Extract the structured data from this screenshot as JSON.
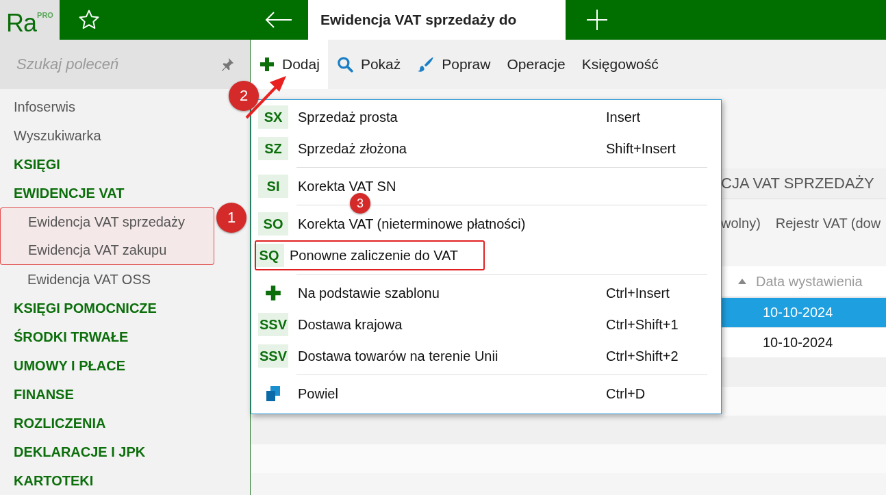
{
  "app": {
    "logo": "Ra",
    "logo_badge": "PRO"
  },
  "tab": {
    "title": "Ewidencja VAT sprzedaży do"
  },
  "search": {
    "placeholder": "Szukaj poleceń"
  },
  "sidebar": {
    "items": [
      {
        "kind": "link",
        "label": "Infoserwis",
        "highlighted": false
      },
      {
        "kind": "link",
        "label": "Wyszukiwarka",
        "highlighted": false
      },
      {
        "kind": "section",
        "label": "KSIĘGI",
        "highlighted": false
      },
      {
        "kind": "section",
        "label": "EWIDENCJE VAT",
        "highlighted": false
      },
      {
        "kind": "sub",
        "label": "Ewidencja VAT sprzedaży",
        "highlighted": true
      },
      {
        "kind": "sub",
        "label": "Ewidencja VAT zakupu",
        "highlighted": true
      },
      {
        "kind": "sub",
        "label": "Ewidencja VAT OSS",
        "highlighted": false
      },
      {
        "kind": "section",
        "label": "KSIĘGI POMOCNICZE",
        "highlighted": false
      },
      {
        "kind": "section",
        "label": "ŚRODKI TRWAŁE",
        "highlighted": false
      },
      {
        "kind": "section",
        "label": "UMOWY I PŁACE",
        "highlighted": false
      },
      {
        "kind": "section",
        "label": "FINANSE",
        "highlighted": false
      },
      {
        "kind": "section",
        "label": "ROZLICZENIA",
        "highlighted": false
      },
      {
        "kind": "section",
        "label": "DEKLARACJE I JPK",
        "highlighted": false
      },
      {
        "kind": "section",
        "label": "KARTOTEKI",
        "highlighted": false
      }
    ]
  },
  "toolbar": [
    {
      "kind": "add",
      "label": "Dodaj",
      "selected": true
    },
    {
      "kind": "search",
      "label": "Pokaż",
      "selected": false
    },
    {
      "kind": "brush",
      "label": "Popraw",
      "selected": false
    },
    {
      "kind": "text",
      "label": "Operacje",
      "selected": false
    },
    {
      "kind": "text",
      "label": "Księgowość",
      "selected": false
    }
  ],
  "menu": [
    {
      "kind": "code",
      "code": "SX",
      "label": "Sprzedaż prosta",
      "shortcut": "Insert",
      "highlighted": false
    },
    {
      "kind": "code",
      "code": "SZ",
      "label": "Sprzedaż złożona",
      "shortcut": "Shift+Insert",
      "highlighted": false
    },
    {
      "kind": "separator"
    },
    {
      "kind": "code",
      "code": "SI",
      "label": "Korekta VAT SN",
      "highlighted": false
    },
    {
      "kind": "separator"
    },
    {
      "kind": "code",
      "code": "SO",
      "label": "Korekta VAT (nieterminowe płatności)",
      "highlighted": false
    },
    {
      "kind": "code",
      "code": "SQ",
      "label": "Ponowne zaliczenie do VAT",
      "highlighted": true
    },
    {
      "kind": "separator"
    },
    {
      "kind": "plus",
      "label": "Na podstawie szablonu",
      "shortcut": "Ctrl+Insert",
      "highlighted": false
    },
    {
      "kind": "code",
      "code": "SSV",
      "label": "Dostawa krajowa",
      "shortcut": "Ctrl+Shift+1",
      "highlighted": false
    },
    {
      "kind": "code",
      "code": "SSV",
      "label": "Dostawa towarów na terenie Unii",
      "shortcut": "Ctrl+Shift+2",
      "highlighted": false
    },
    {
      "kind": "separator"
    },
    {
      "kind": "copy",
      "label": "Powiel",
      "shortcut": "Ctrl+D",
      "highlighted": false
    }
  ],
  "view": {
    "title": "CJA VAT SPRZEDAŻY",
    "tabs": [
      "wolny)",
      "Rejestr VAT (dow"
    ],
    "columns": [
      "Data wystawienia"
    ],
    "rows": [
      {
        "cells": [
          "10-10-2024"
        ],
        "selected": true
      },
      {
        "cells": [
          "10-10-2024"
        ],
        "selected": false
      }
    ]
  },
  "annotations": [
    {
      "label": "1"
    },
    {
      "label": "2"
    },
    {
      "label": "3"
    }
  ]
}
